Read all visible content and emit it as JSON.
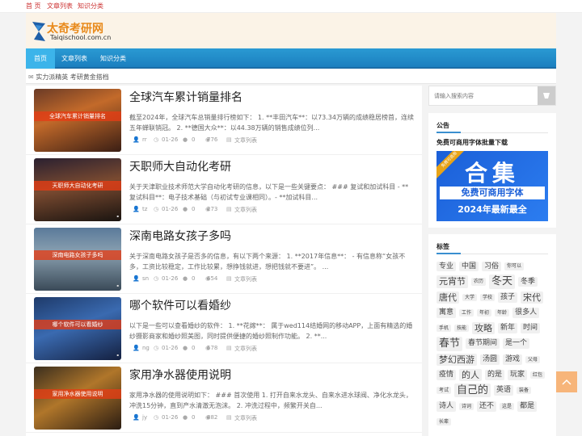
{
  "topbar": {
    "links": [
      "首 页",
      "文章列表",
      "知识分类"
    ]
  },
  "header": {
    "logo_title": "太奇考研网",
    "logo_sub": "Taiqischool.com.cn"
  },
  "nav": {
    "items": [
      "首页",
      "文章列表",
      "知识分类"
    ],
    "active_index": 0
  },
  "notice": {
    "icon": "mail-icon",
    "text": "实力派精英 考研黄金搭档"
  },
  "articles": [
    {
      "title": "全球汽车累计销量排名",
      "thumb_label": "全球汽车累计销量排名",
      "summary": "截至2024年，全球汽车总销量排行榜如下： 1. **丰田汽车**：以73.34万辆的成绩稳居榜首，连续五年蝉联销冠。 2. **德国大众**：以44.38万辆的销售成绩位列...",
      "author": "rr",
      "date": "01-26",
      "comments": "0",
      "views": "776",
      "category": "文章列表"
    },
    {
      "title": "天职师大自动化考研",
      "thumb_label": "天职师大自动化考研",
      "summary": "关于天津职业技术师范大学自动化考研的信息，以下是一些关键要点： ### 复试和加试科目 - **复试科目**：电子技术基础（与初试专业课相同）。- **加试科目...",
      "author": "tz",
      "date": "01-26",
      "comments": "0",
      "views": "273",
      "category": "文章列表"
    },
    {
      "title": "深南电路女孩子多吗",
      "thumb_label": "深南电路女孩子多吗",
      "summary": "关于深南电路女孩子是否多的信息，有以下两个来源： 1. **2017年信息**： - 有信息称“女孩不多，工资比较稳定，工作比较累，想挣钱就进，想把钱就不要进”。 ...",
      "author": "sn",
      "date": "01-26",
      "comments": "0",
      "views": "654",
      "category": "文章列表"
    },
    {
      "title": "哪个软件可以看婚纱",
      "thumb_label": "哪个软件可以看婚纱",
      "summary": "以下是一些可以查看婚纱的软件： 1. **花嫁**： 属于wed114结婚网的移动APP，上面有精选的婚纱摄影商家和婚纱照美图，同时提供便捷的婚纱照制作功能。 2. **...",
      "author": "ng",
      "date": "01-26",
      "comments": "0",
      "views": "578",
      "category": "文章列表"
    },
    {
      "title": "家用净水器使用说明",
      "thumb_label": "家用净水器使用说明",
      "summary": "家用净水器的使用说明如下： ### 首次使用 1. 打开自来水龙头、自来水进水球阀、净化水龙头，冲洗15分钟，直到产水清澈无泡沫。 2. 冲洗过程中，频繁开关自...",
      "author": "jy",
      "date": "01-26",
      "comments": "0",
      "views": "882",
      "category": "文章列表"
    }
  ],
  "search": {
    "placeholder": "请输入搜索内容"
  },
  "announcement": {
    "heading": "公告",
    "text": "免费可商用字体批量下载",
    "banner_ribbon": "免费可商用",
    "banner_big": "合集",
    "banner_mid": "免费可商用字体",
    "banner_bottom": "2024年最新最全"
  },
  "tags_widget": {
    "heading": "标签",
    "tags": [
      {
        "text": "专业",
        "size": "m"
      },
      {
        "text": "中国",
        "size": "m"
      },
      {
        "text": "习俗",
        "size": "m"
      },
      {
        "text": "你可以",
        "size": "s"
      },
      {
        "text": "元宵节",
        "size": "l"
      },
      {
        "text": "农历",
        "size": "s"
      },
      {
        "text": "冬天",
        "size": "xl"
      },
      {
        "text": "冬季",
        "size": "m"
      },
      {
        "text": "唐代",
        "size": "l"
      },
      {
        "text": "大学",
        "size": "s"
      },
      {
        "text": "学校",
        "size": "s"
      },
      {
        "text": "孩子",
        "size": "m"
      },
      {
        "text": "宋代",
        "size": "l"
      },
      {
        "text": "寓意",
        "size": "m"
      },
      {
        "text": "工作",
        "size": "s"
      },
      {
        "text": "年初",
        "size": "s"
      },
      {
        "text": "年龄",
        "size": "s"
      },
      {
        "text": "很多人",
        "size": "m"
      },
      {
        "text": "手机",
        "size": "s"
      },
      {
        "text": "技能",
        "size": "s"
      },
      {
        "text": "攻略",
        "size": "l"
      },
      {
        "text": "新年",
        "size": "m"
      },
      {
        "text": "时间",
        "size": "m"
      },
      {
        "text": "春节",
        "size": "xl"
      },
      {
        "text": "春节期间",
        "size": "m"
      },
      {
        "text": "是一个",
        "size": "m"
      },
      {
        "text": "梦幻西游",
        "size": "l"
      },
      {
        "text": "汤圆",
        "size": "m"
      },
      {
        "text": "游戏",
        "size": "m"
      },
      {
        "text": "父母",
        "size": "s"
      },
      {
        "text": "疫情",
        "size": "m"
      },
      {
        "text": "的人",
        "size": "l"
      },
      {
        "text": "的是",
        "size": "m"
      },
      {
        "text": "玩家",
        "size": "m"
      },
      {
        "text": "红包",
        "size": "s"
      },
      {
        "text": "考试",
        "size": "s"
      },
      {
        "text": "自己的",
        "size": "xl"
      },
      {
        "text": "英语",
        "size": "m"
      },
      {
        "text": "装备",
        "size": "s"
      },
      {
        "text": "诗人",
        "size": "m"
      },
      {
        "text": "诗词",
        "size": "s"
      },
      {
        "text": "还不",
        "size": "m"
      },
      {
        "text": "这是",
        "size": "s"
      },
      {
        "text": "都是",
        "size": "m"
      },
      {
        "text": "长辈",
        "size": "s"
      }
    ]
  }
}
